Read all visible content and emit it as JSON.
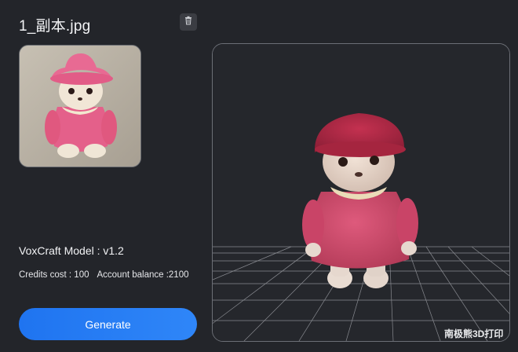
{
  "file": {
    "name": "1_副本.jpg"
  },
  "icons": {
    "delete": "trash-icon"
  },
  "model": {
    "label": "VoxCraft Model : v1.2"
  },
  "credits": {
    "cost": "Credits cost : 100",
    "balance": "Account balance :2100"
  },
  "actions": {
    "generate_label": "Generate"
  },
  "watermark": {
    "text": "南极熊3D打印"
  },
  "colors": {
    "background": "#23252a",
    "accent": "#2f86f8",
    "border": "#6c6f76"
  }
}
